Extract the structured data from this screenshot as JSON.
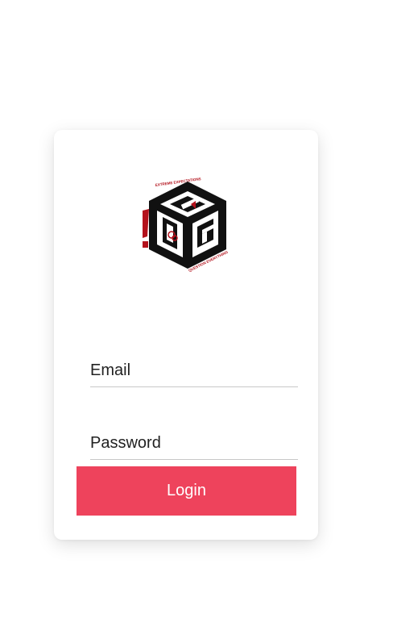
{
  "logo": {
    "icon": "cube-logo-icon",
    "brand_top": "EXTREME EXPECTATIONS",
    "brand_bottom": "QUESTION EVERYTHING",
    "colors": {
      "dark": "#111111",
      "accent": "#b3121c"
    }
  },
  "form": {
    "email_placeholder": "Email",
    "email_value": "",
    "password_placeholder": "Password",
    "password_value": "",
    "login_label": "Login"
  },
  "colors": {
    "button": "#ee435c",
    "button_text": "#ffffff",
    "underline": "#c8c8c8"
  }
}
